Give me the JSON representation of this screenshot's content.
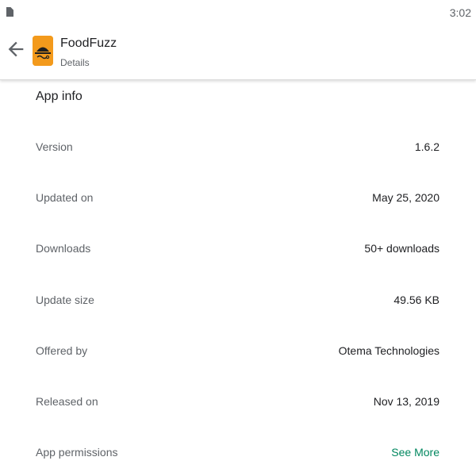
{
  "status_bar": {
    "time": "3:02"
  },
  "toolbar": {
    "app_name": "FoodFuzz",
    "subtitle": "Details",
    "back_icon": "arrow-back-icon",
    "app_icon": "foodfuzz-app-icon",
    "app_icon_color": "#f39a1c"
  },
  "section": {
    "title": "App info"
  },
  "rows": [
    {
      "label": "Version",
      "value": "1.6.2"
    },
    {
      "label": "Updated on",
      "value": "May 25, 2020"
    },
    {
      "label": "Downloads",
      "value": "50+ downloads"
    },
    {
      "label": "Update size",
      "value": "49.56 KB"
    },
    {
      "label": "Offered by",
      "value": "Otema Technologies"
    },
    {
      "label": "Released on",
      "value": "Nov 13, 2019"
    },
    {
      "label": "App permissions",
      "value": "See More"
    }
  ],
  "colors": {
    "link": "#01875f",
    "label": "#5f6368",
    "text": "#202124"
  }
}
